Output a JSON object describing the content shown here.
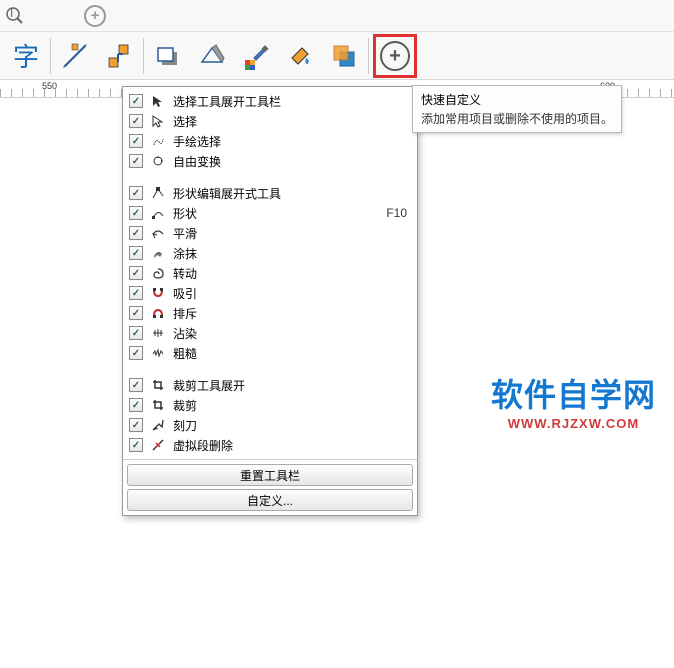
{
  "toolbar_top": {
    "zoom_icon": "zoom",
    "plus_icon": "plus"
  },
  "main_tools": [
    "字"
  ],
  "ruler": {
    "marks": [
      "550",
      "600"
    ]
  },
  "tooltip": {
    "title": "快速自定义",
    "desc": "添加常用项目或删除不使用的项目。"
  },
  "dropdown": {
    "groups": [
      {
        "items": [
          {
            "label": "选择工具展开工具栏",
            "shortcut": ""
          },
          {
            "label": "选择",
            "shortcut": ""
          },
          {
            "label": "手绘选择",
            "shortcut": ""
          },
          {
            "label": "自由变换",
            "shortcut": ""
          }
        ]
      },
      {
        "items": [
          {
            "label": "形状编辑展开式工具",
            "shortcut": ""
          },
          {
            "label": "形状",
            "shortcut": "F10"
          },
          {
            "label": "平滑",
            "shortcut": ""
          },
          {
            "label": "涂抹",
            "shortcut": ""
          },
          {
            "label": "转动",
            "shortcut": ""
          },
          {
            "label": "吸引",
            "shortcut": ""
          },
          {
            "label": "排斥",
            "shortcut": ""
          },
          {
            "label": "沾染",
            "shortcut": ""
          },
          {
            "label": "粗糙",
            "shortcut": ""
          }
        ]
      },
      {
        "items": [
          {
            "label": "裁剪工具展开",
            "shortcut": ""
          },
          {
            "label": "裁剪",
            "shortcut": ""
          },
          {
            "label": "刻刀",
            "shortcut": ""
          },
          {
            "label": "虚拟段删除",
            "shortcut": ""
          }
        ]
      }
    ],
    "reset_btn": "重置工具栏",
    "custom_btn": "自定义..."
  },
  "watermark": {
    "main": "软件自学网",
    "sub": "WWW.RJZXW.COM"
  }
}
